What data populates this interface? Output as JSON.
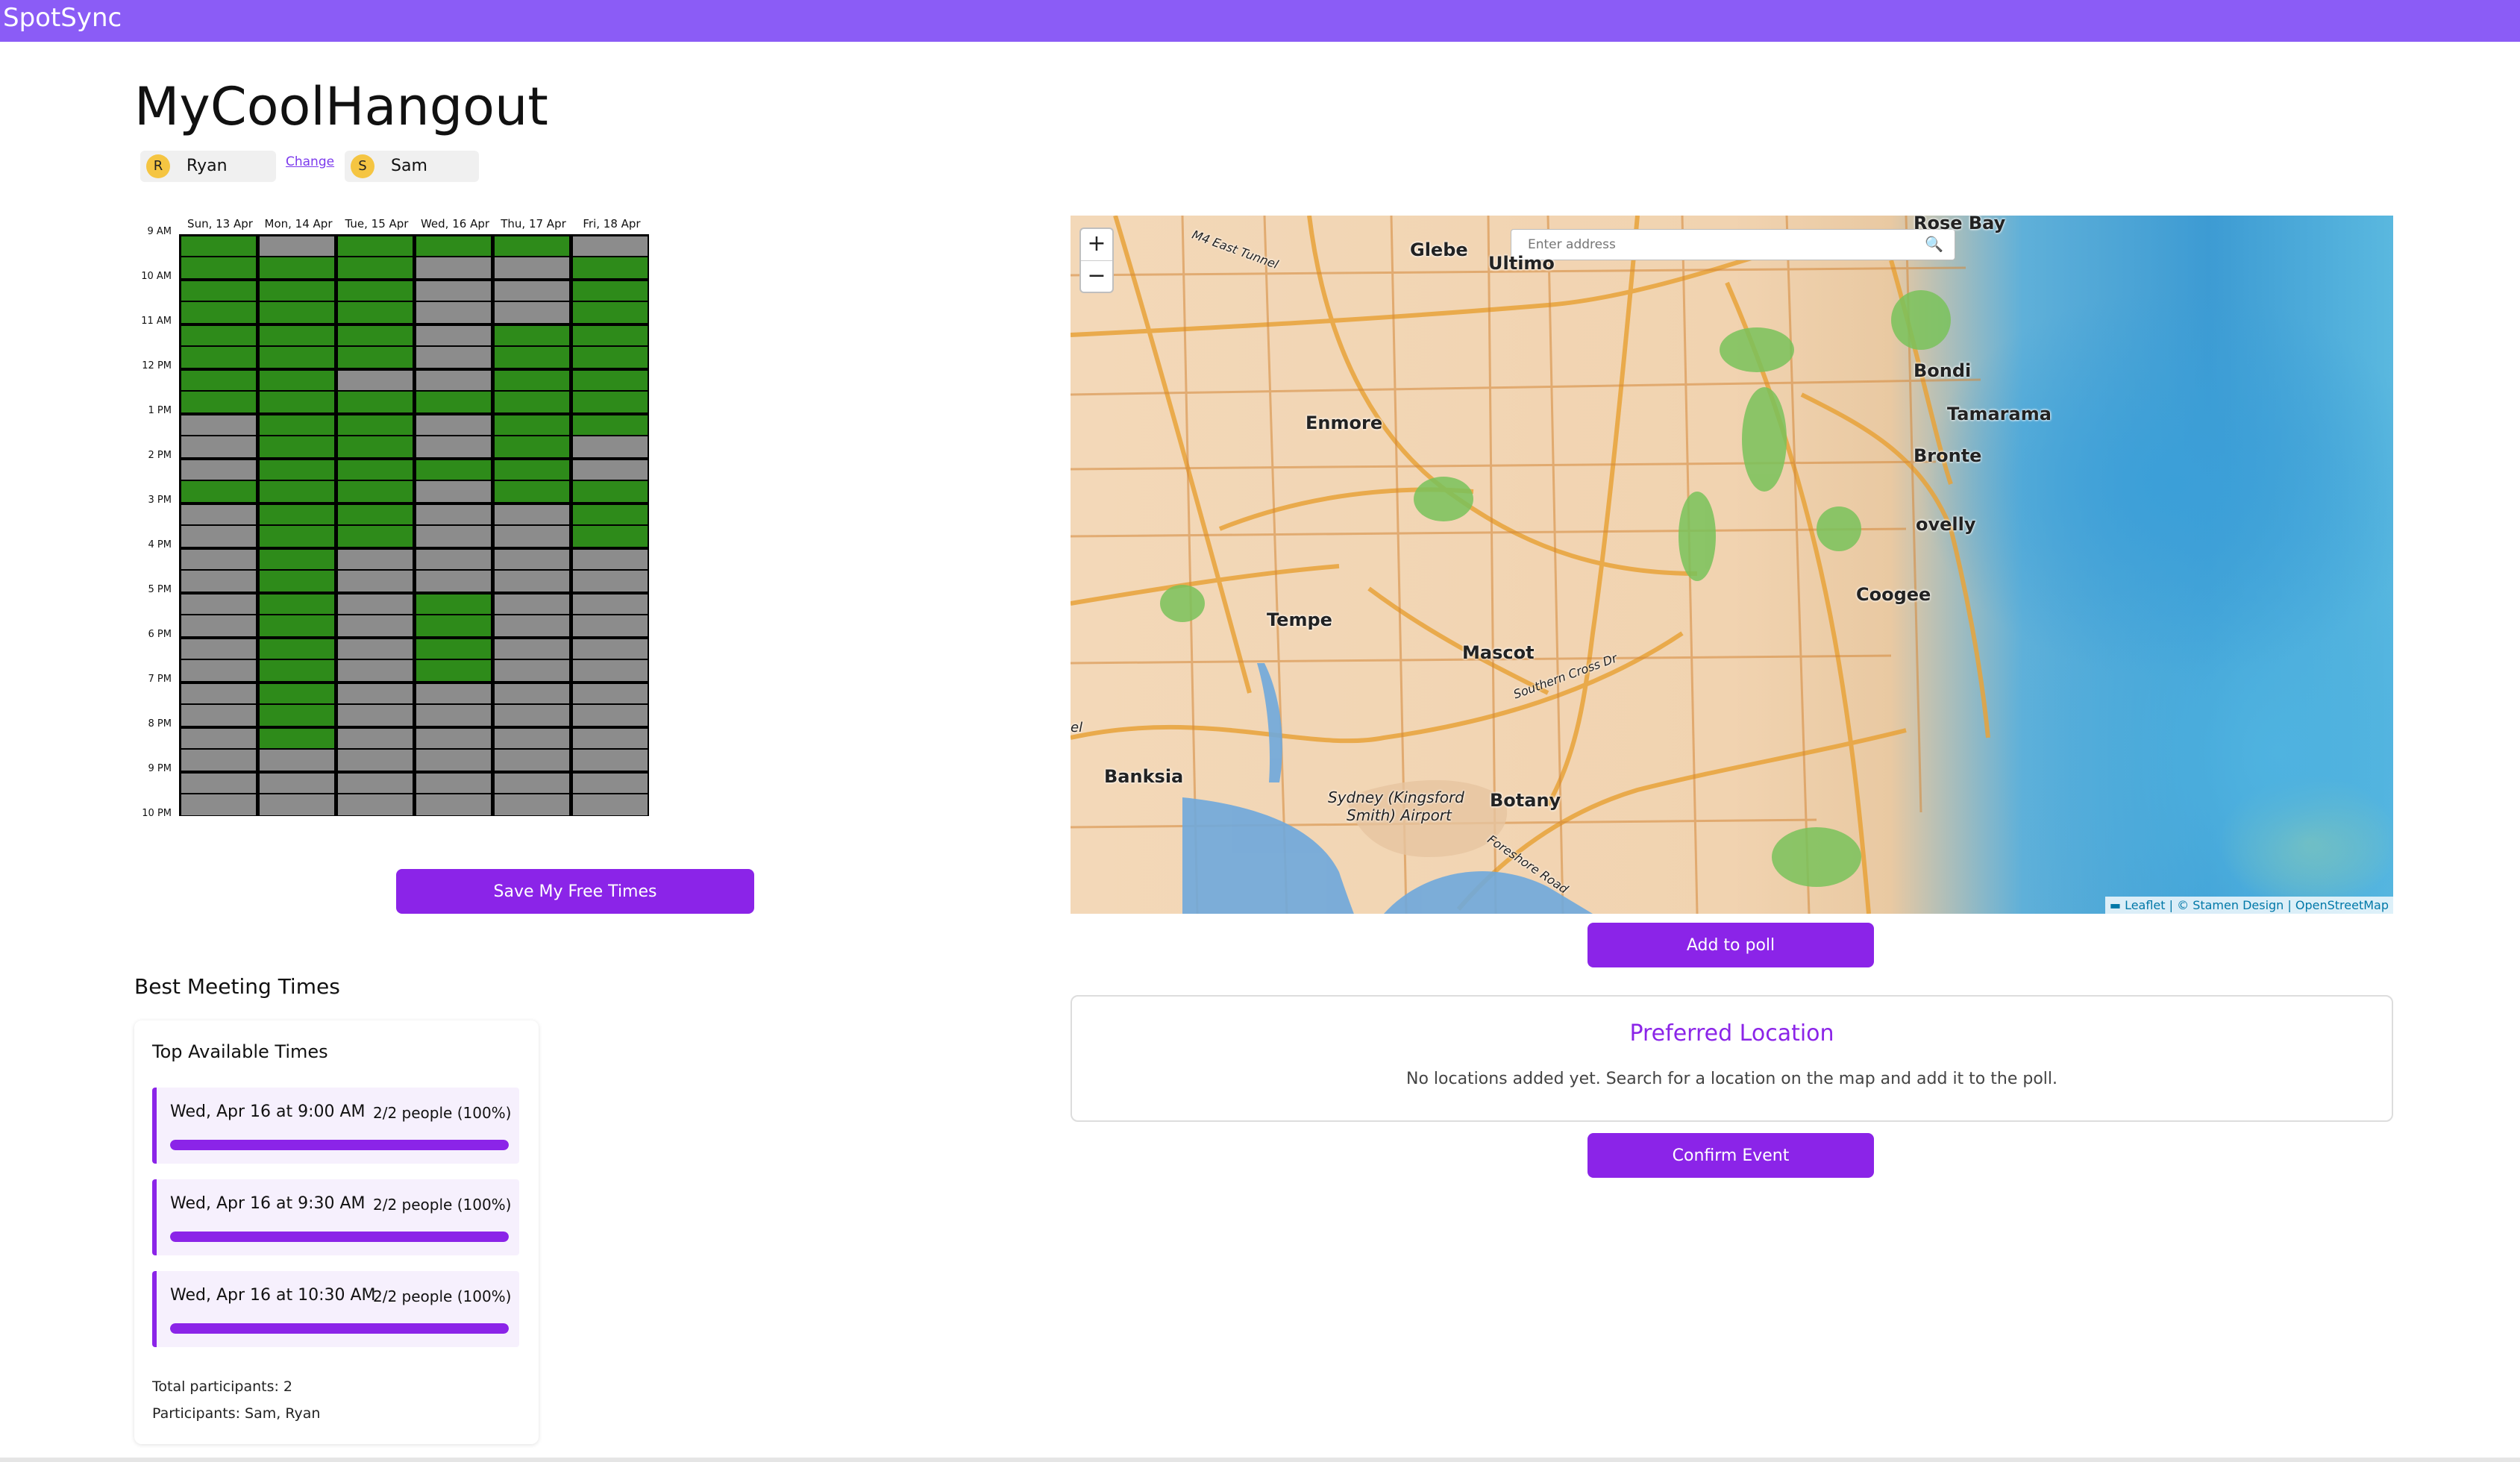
{
  "app": {
    "name": "SpotSync",
    "accent": "#8b5cf6",
    "button_color": "#8b24e8"
  },
  "event": {
    "title": "MyCoolHangout"
  },
  "participants_bar": {
    "users": [
      {
        "initial": "R",
        "name": "Ryan"
      },
      {
        "initial": "S",
        "name": "Sam"
      }
    ],
    "change_label": "Change"
  },
  "schedule": {
    "days": [
      "Sun, 13 Apr",
      "Mon, 14 Apr",
      "Tue, 15 Apr",
      "Wed, 16 Apr",
      "Thu, 17 Apr",
      "Fri, 18 Apr"
    ],
    "times": [
      "9 AM",
      "10 AM",
      "11 AM",
      "12 PM",
      "1 PM",
      "2 PM",
      "3 PM",
      "4 PM",
      "5 PM",
      "6 PM",
      "7 PM",
      "8 PM",
      "9 PM",
      "10 PM"
    ],
    "colors": {
      "free": "#2e8b1a",
      "busy": "#8c8c8c"
    },
    "free_slots": [
      "GGGGGGGGBBBGBBBBBBBBBBBBBB",
      "BGGGGGGGGGGGGGGGGGGGGGGBBB",
      "GGGGGGBGGGGGGGBBBBBBBBBBBB",
      "GBBBBBBGBBGBBBBBGGGGBBBBBB",
      "GBBBGGGGGGGGBBBBBBBBBBBBBB",
      "BGGGGGGGGBBGGGBBBBBBBBBBBB"
    ],
    "save_button": "Save My Free Times"
  },
  "best_times": {
    "section_title": "Best Meeting Times",
    "card_title": "Top Available Times",
    "slots": [
      {
        "when": "Wed, Apr 16 at 9:00 AM",
        "people": "2/2 people (100%)",
        "ratio": 1.0
      },
      {
        "when": "Wed, Apr 16 at 9:30 AM",
        "people": "2/2 people (100%)",
        "ratio": 1.0
      },
      {
        "when": "Wed, Apr 16 at 10:30 AM",
        "people": "2/2 people (100%)",
        "ratio": 1.0
      }
    ],
    "total": "Total participants: 2",
    "names": "Participants: Sam, Ryan"
  },
  "map": {
    "search_placeholder": "Enter address",
    "zoom_in": "+",
    "zoom_out": "−",
    "search_icon": "🔍",
    "places": [
      "Rose Bay",
      "Glebe",
      "Ultimo",
      "Bondi",
      "Tamarama",
      "Enmore",
      "Bronte",
      "ovelly",
      "Coogee",
      "Tempe",
      "Mascot",
      "Banksia",
      "Botany",
      "Sydney (Kingsford",
      "Smith) Airport",
      "el"
    ],
    "road_labels": [
      "M4 East Tunnel",
      "Southern Cross Dr",
      "Foreshore Road"
    ],
    "attribution": "▬ Leaflet | © Stamen Design | OpenStreetMap"
  },
  "actions": {
    "add_to_poll": "Add to poll",
    "confirm_event": "Confirm Event"
  },
  "preferred_location": {
    "title": "Preferred Location",
    "empty_message": "No locations added yet. Search for a location on the map and add it to the poll."
  }
}
